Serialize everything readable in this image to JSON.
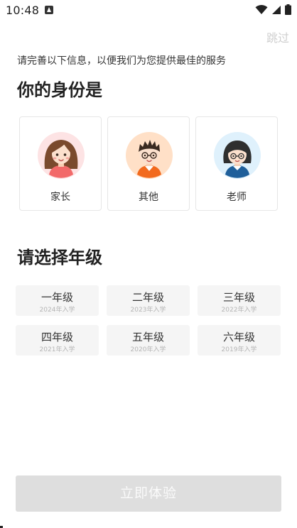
{
  "status_bar": {
    "time": "10:48",
    "icons": [
      "app-notification-icon",
      "wifi-icon",
      "signal-icon",
      "battery-icon"
    ]
  },
  "skip_label": "跳过",
  "subtitle": "请完善以下信息，以便我们为您提供最佳的服务",
  "identity_title": "你的身份是",
  "roles": [
    {
      "label": "家长",
      "icon": "parent-avatar-icon",
      "bg": "#fde3e4"
    },
    {
      "label": "其他",
      "icon": "other-avatar-icon",
      "bg": "#ffe0c7"
    },
    {
      "label": "老师",
      "icon": "teacher-avatar-icon",
      "bg": "#dff1fc"
    }
  ],
  "grade_title": "请选择年级",
  "grades": [
    {
      "name": "一年级",
      "year": "2024年入学"
    },
    {
      "name": "二年级",
      "year": "2023年入学"
    },
    {
      "name": "三年级",
      "year": "2022年入学"
    },
    {
      "name": "四年级",
      "year": "2021年入学"
    },
    {
      "name": "五年级",
      "year": "2020年入学"
    },
    {
      "name": "六年级",
      "year": "2019年入学"
    }
  ],
  "cta_label": "立即体验",
  "colors": {
    "cta_disabled_bg": "#dedede",
    "grade_bg": "#f5f5f5",
    "skip_text": "#cfcfcf",
    "card_border": "#e6e6e6"
  }
}
